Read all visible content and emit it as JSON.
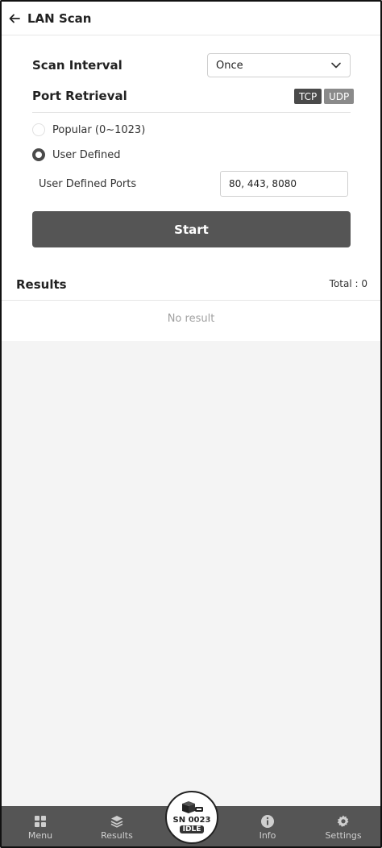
{
  "header": {
    "title": "LAN Scan"
  },
  "scan_interval": {
    "label": "Scan Interval",
    "selected": "Once"
  },
  "port_retrieval": {
    "label": "Port Retrieval",
    "tags": {
      "tcp": "TCP",
      "udp": "UDP"
    },
    "options": [
      {
        "label": "Popular (0~1023)",
        "selected": false
      },
      {
        "label": "User Defined",
        "selected": true
      }
    ]
  },
  "user_defined_ports": {
    "label": "User Defined Ports",
    "value": "80, 443, 8080"
  },
  "start_button": {
    "label": "Start"
  },
  "results": {
    "title": "Results",
    "total": "Total : 0",
    "empty": "No result"
  },
  "bottom_nav": {
    "menu": "Menu",
    "results": "Results",
    "info": "Info",
    "settings": "Settings"
  },
  "device": {
    "serial": "SN 0023",
    "status": "IDLE"
  },
  "colors": {
    "accent": "#555555",
    "tag_tcp": "#4a4a4a",
    "tag_udp": "#8a8a8a",
    "background": "#f4f4f4"
  }
}
